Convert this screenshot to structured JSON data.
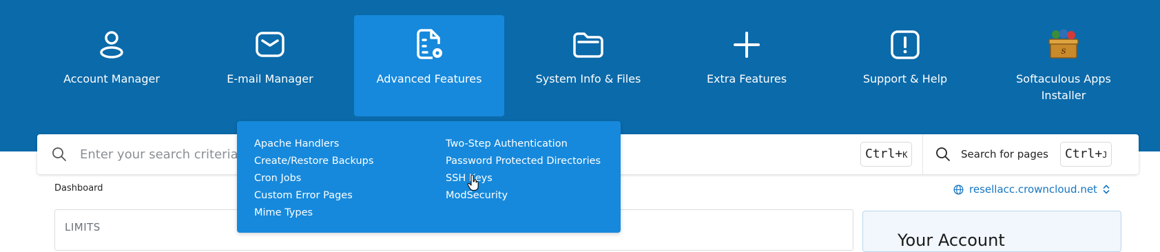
{
  "nav": {
    "items": [
      {
        "label": "Account Manager",
        "icon": "user-icon"
      },
      {
        "label": "E-mail Manager",
        "icon": "envelope-icon"
      },
      {
        "label": "Advanced Features",
        "icon": "document-gear-icon"
      },
      {
        "label": "System Info & Files",
        "icon": "folder-icon"
      },
      {
        "label": "Extra Features",
        "icon": "plus-icon"
      },
      {
        "label": "Support & Help",
        "icon": "exclamation-icon"
      },
      {
        "label": "Softaculous Apps Installer",
        "icon": "softaculous-icon"
      }
    ],
    "active": "Advanced Features"
  },
  "dropdown": {
    "col1": [
      "Apache Handlers",
      "Create/Restore Backups",
      "Cron Jobs",
      "Custom Error Pages",
      "Mime Types"
    ],
    "col2": [
      "Two-Step Authentication",
      "Password Protected Directories",
      "SSH Keys",
      "ModSecurity"
    ]
  },
  "search": {
    "placeholder": "Enter your search criteria",
    "shortcut_main": "Ctrl+",
    "shortcut_key": "K",
    "pages_label": "Search for pages",
    "pages_shortcut_main": "Ctrl+",
    "pages_shortcut_key": "J"
  },
  "breadcrumb": "Dashboard",
  "domain": "resellacc.crowncloud.net",
  "limits_title": "LIMITS",
  "account_title": "Your Account",
  "colors": {
    "topbar": "#0b6aaa",
    "active": "#1689dc",
    "link": "#1475c2"
  }
}
